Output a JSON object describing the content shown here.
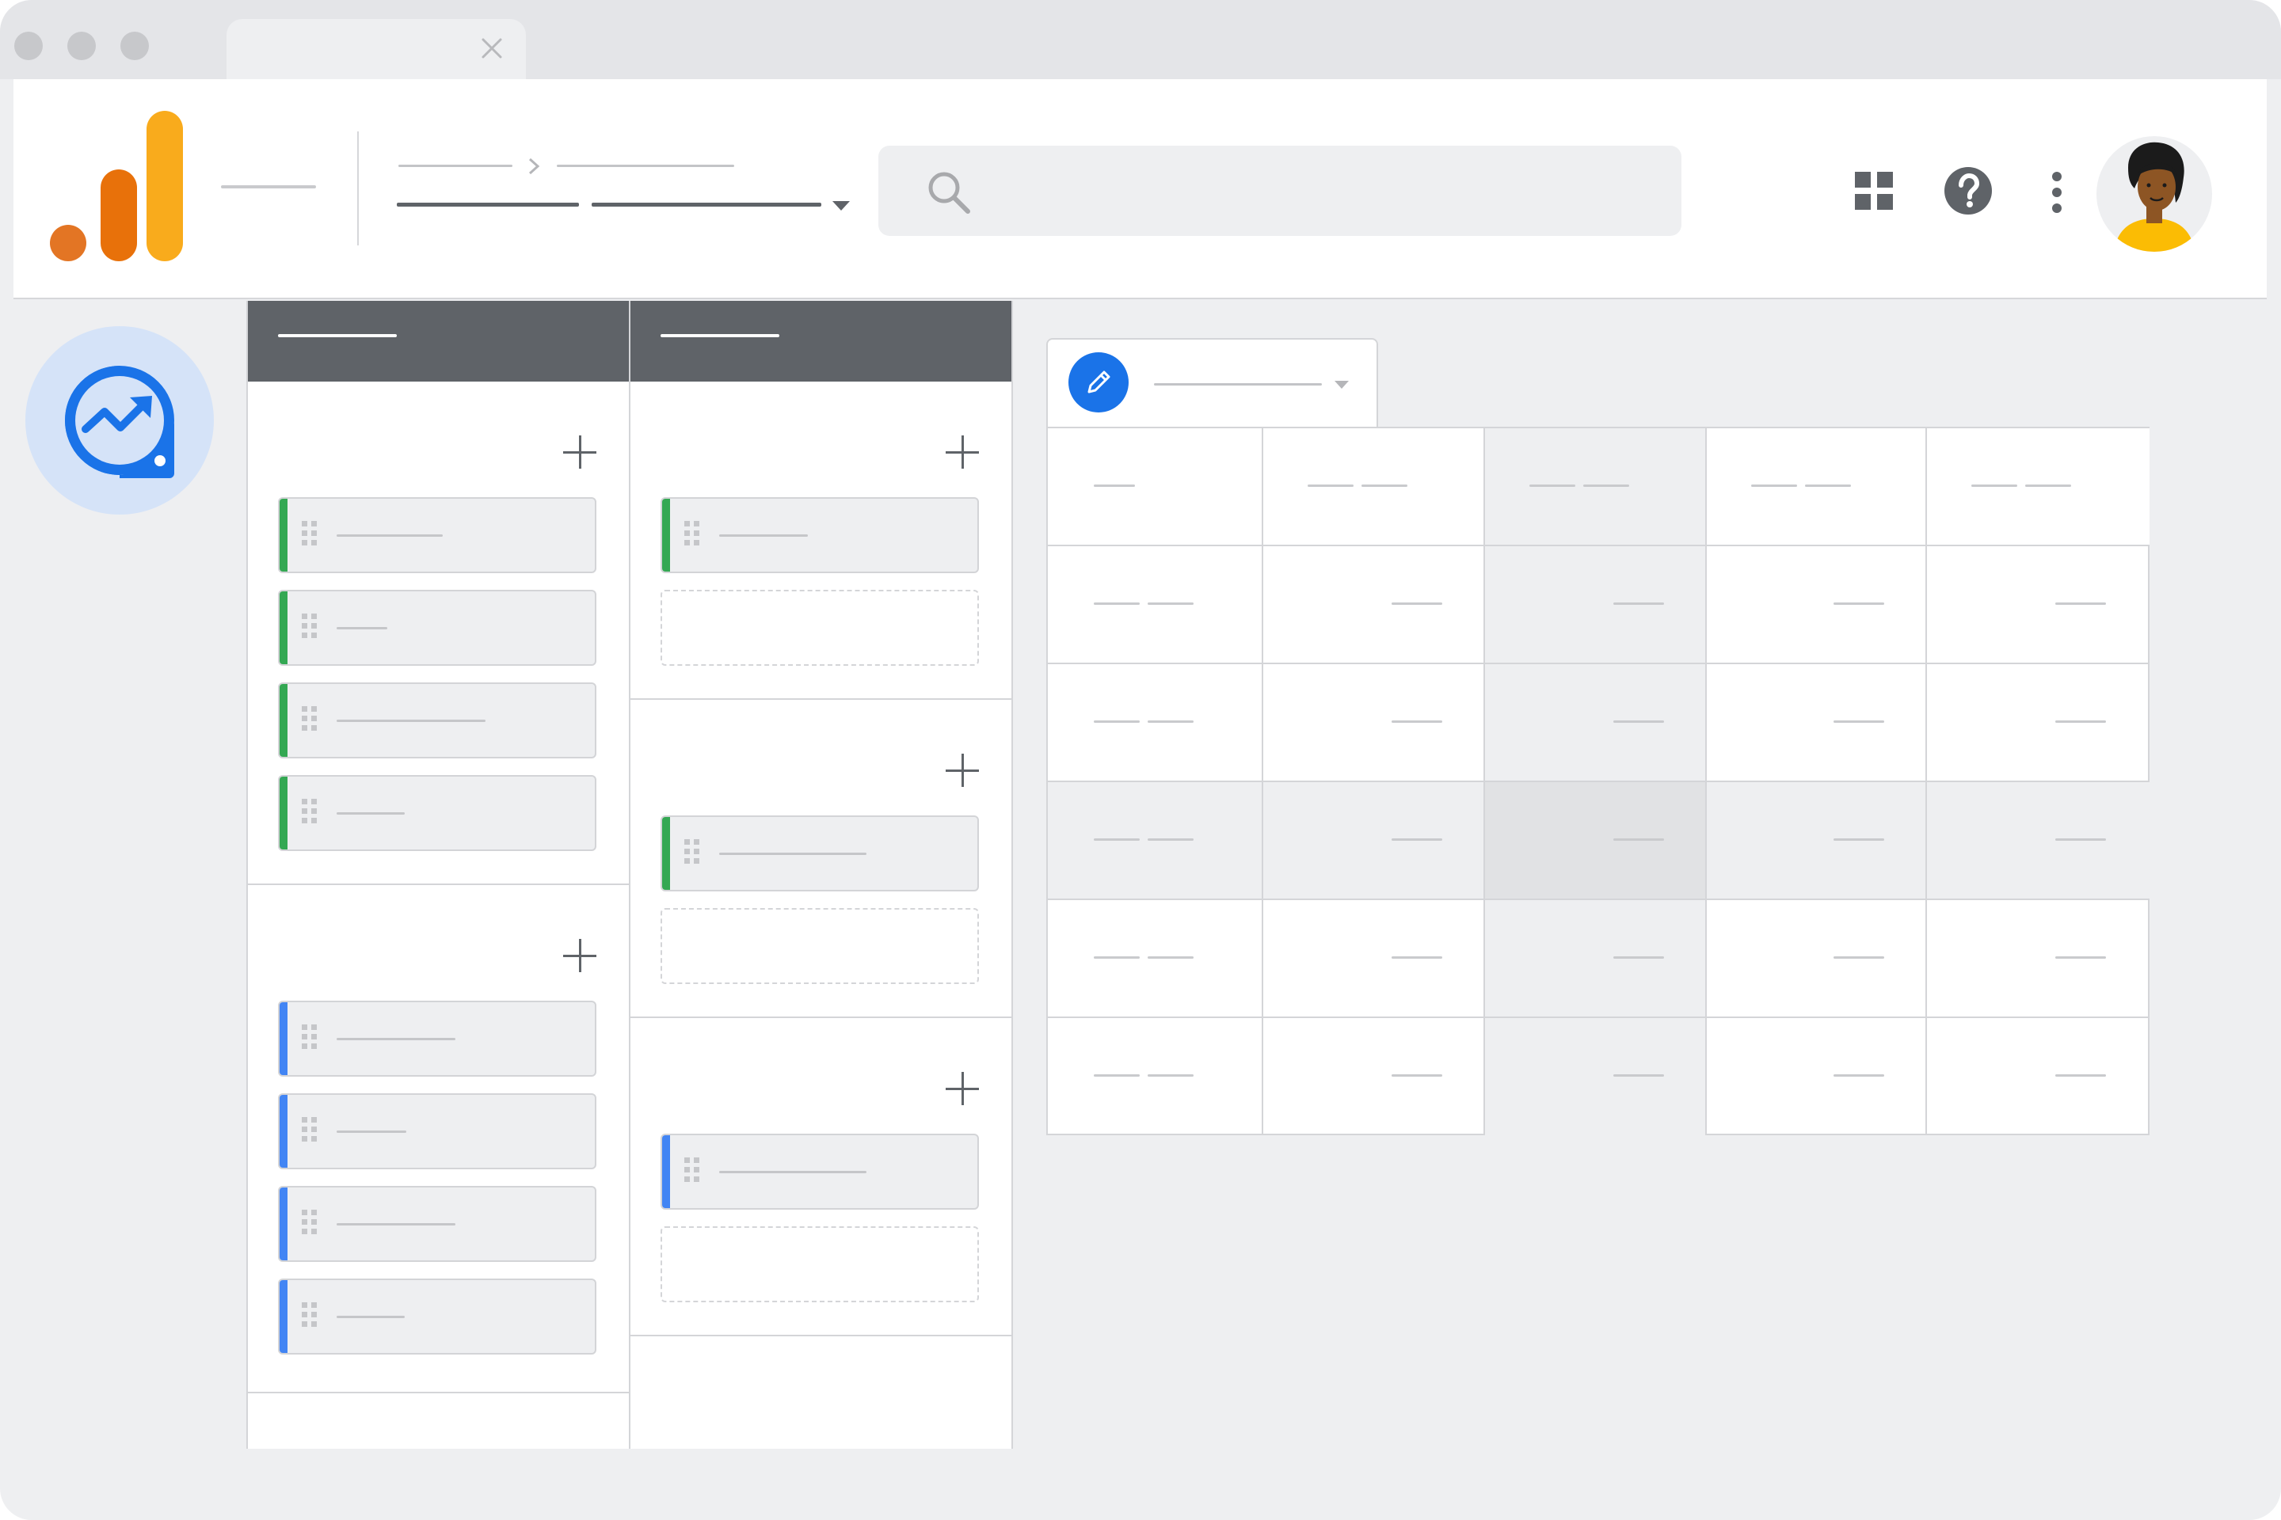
{
  "window": {
    "traffic_lights": [
      "close",
      "minimize",
      "maximize"
    ],
    "tab": {
      "title": "",
      "close_icon": "close-icon"
    }
  },
  "appbar": {
    "logo_icon": "analytics-logo-icon",
    "breadcrumb": {
      "parent": "",
      "child": "",
      "current": ""
    },
    "search": {
      "placeholder": "",
      "icon": "search-icon"
    },
    "icons": [
      "apps-grid-icon",
      "help-icon",
      "more-vert-icon"
    ],
    "avatar": "user-avatar"
  },
  "rail": {
    "explore_icon": "explore-trend-icon"
  },
  "panels": [
    {
      "header": "",
      "sections": [
        {
          "chips": [
            {
              "label": "",
              "color": "#34a853"
            },
            {
              "label": "",
              "color": "#34a853"
            },
            {
              "label": "",
              "color": "#34a853"
            },
            {
              "label": "",
              "color": "#34a853"
            }
          ]
        },
        {
          "chips": [
            {
              "label": "",
              "color": "#4285f4"
            },
            {
              "label": "",
              "color": "#4285f4"
            },
            {
              "label": "",
              "color": "#4285f4"
            },
            {
              "label": "",
              "color": "#4285f4"
            }
          ]
        }
      ]
    },
    {
      "header": "",
      "sections": [
        {
          "chips": [
            {
              "label": "",
              "color": "#34a853"
            }
          ],
          "drop_slots": 1
        },
        {
          "chips": [
            {
              "label": "",
              "color": "#34a853"
            }
          ],
          "drop_slots": 1
        },
        {
          "chips": [
            {
              "label": "",
              "color": "#4285f4"
            }
          ],
          "drop_slots": 1
        }
      ]
    }
  ],
  "report": {
    "tab": {
      "label": "",
      "edit_icon": "pencil-icon",
      "dropdown_icon": "caret-down-icon"
    },
    "columns": 5,
    "rows": 6,
    "highlight_column": 3,
    "highlight_row": 4,
    "cells": []
  },
  "colors": {
    "accent": "#1a73e8",
    "logo_orange_dark": "#e37524",
    "logo_orange": "#e8710a",
    "logo_yellow": "#f9ab1c",
    "dimension_green": "#34a853",
    "metric_blue": "#4285f4",
    "panel_header": "#5f6368"
  }
}
